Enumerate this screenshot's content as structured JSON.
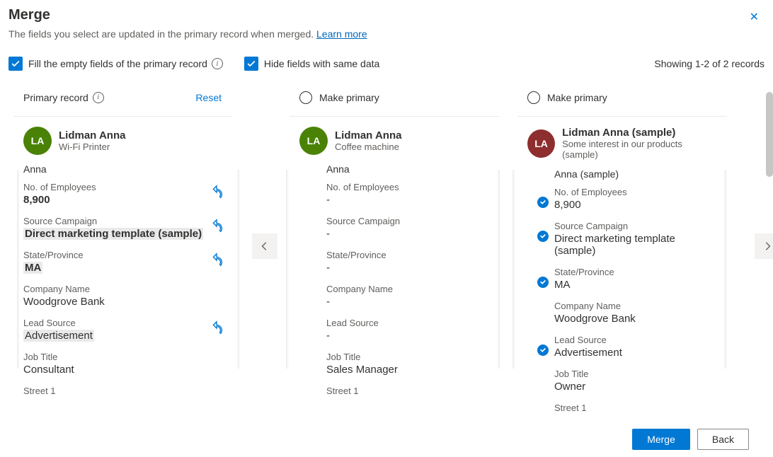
{
  "header": {
    "title": "Merge",
    "subtitle_prefix": "The fields you select are updated in the primary record when merged. ",
    "learn_more": "Learn more"
  },
  "options": {
    "fill_empty": "Fill the empty fields of the primary record",
    "hide_same": "Hide fields with same data",
    "showing": "Showing 1-2 of 2 records"
  },
  "columns": {
    "primary_label": "Primary record",
    "reset": "Reset",
    "make_primary": "Make primary"
  },
  "labels": {
    "employees": "No. of Employees",
    "campaign": "Source Campaign",
    "state": "State/Province",
    "company": "Company Name",
    "lead_source": "Lead Source",
    "job_title": "Job Title",
    "street1": "Street 1"
  },
  "avatar_initials": "LA",
  "records": [
    {
      "name": "Lidman Anna",
      "sub": "Wi-Fi Printer",
      "topic": "Anna",
      "employees": "8,900",
      "campaign": "Direct marketing template (sample)",
      "state": "MA",
      "company": "Woodgrove Bank",
      "lead_source": "Advertisement",
      "job_title": "Consultant",
      "street1": ""
    },
    {
      "name": "Lidman Anna",
      "sub": "Coffee machine",
      "topic": "Anna",
      "employees": "-",
      "campaign": "-",
      "state": "-",
      "company": "-",
      "lead_source": "-",
      "job_title": "Sales Manager",
      "street1": ""
    },
    {
      "name": "Lidman Anna (sample)",
      "sub": "Some interest in our products (sample)",
      "topic": "Anna (sample)",
      "employees": "8,900",
      "campaign": "Direct marketing template (sample)",
      "state": "MA",
      "company": "Woodgrove Bank",
      "lead_source": "Advertisement",
      "job_title": "Owner",
      "street1": ""
    }
  ],
  "buttons": {
    "merge": "Merge",
    "back": "Back"
  }
}
